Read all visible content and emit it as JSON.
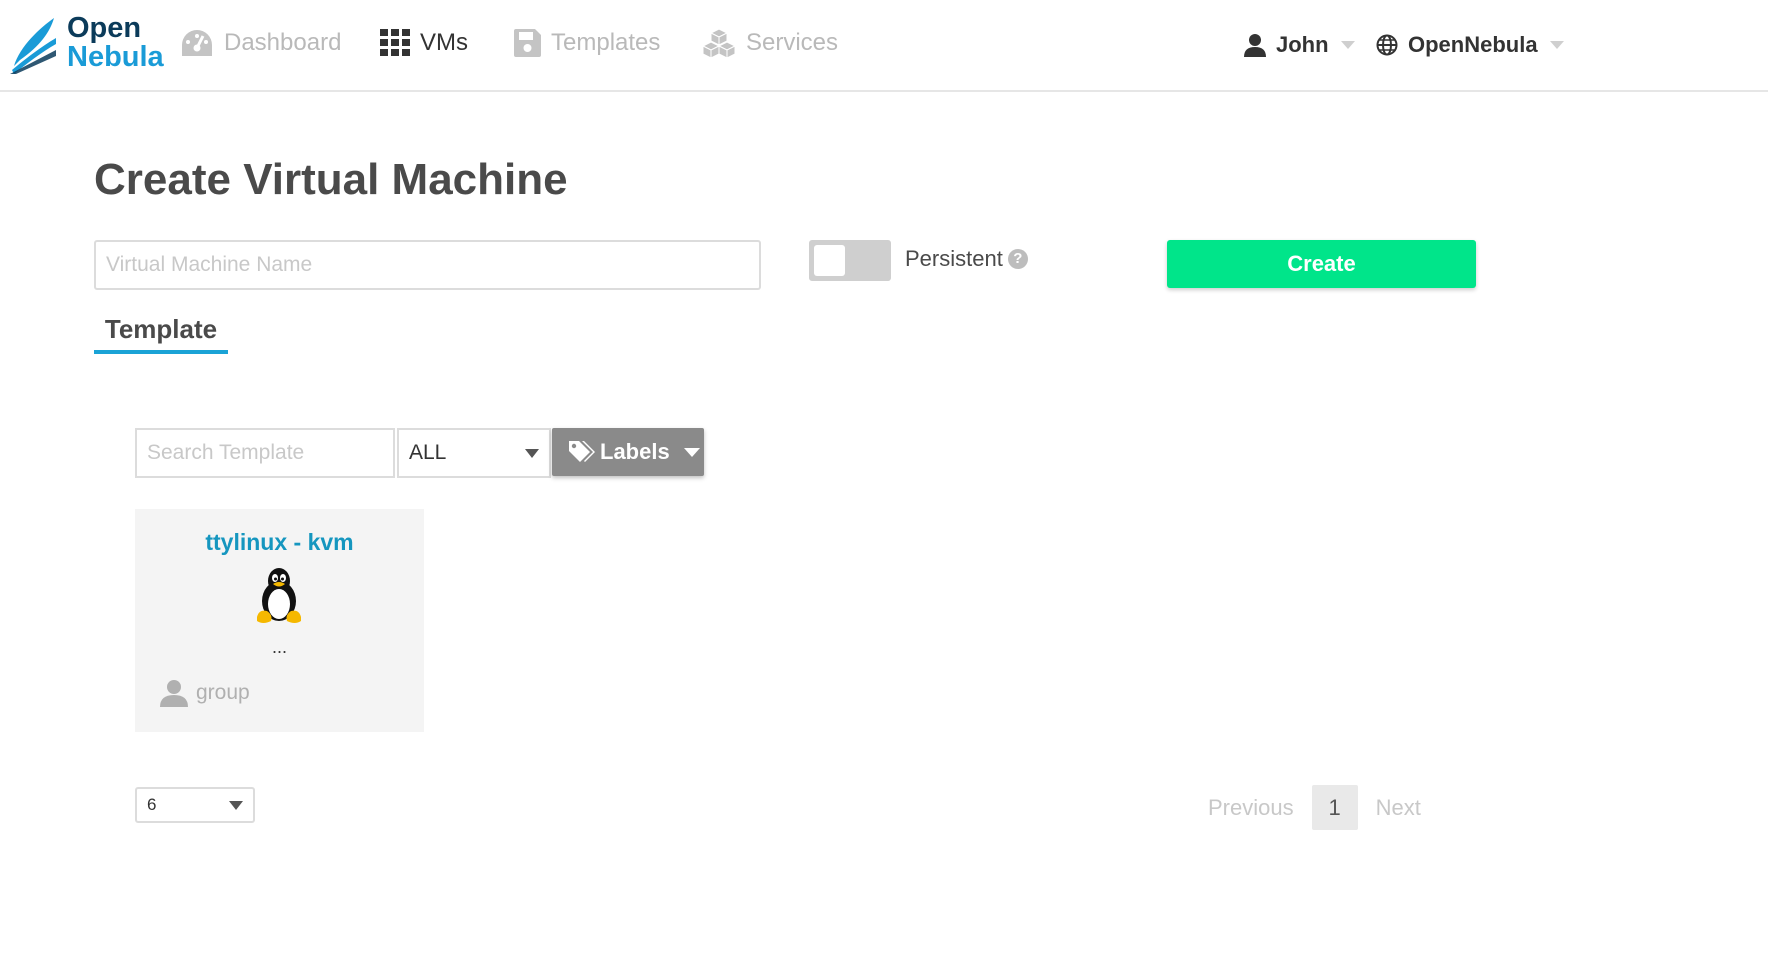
{
  "brand": {
    "line1": "Open",
    "line2": "Nebula"
  },
  "nav": {
    "dashboard": "Dashboard",
    "vms": "VMs",
    "templates": "Templates",
    "services": "Services"
  },
  "user_menu": {
    "user": "John",
    "zone": "OpenNebula"
  },
  "page": {
    "title": "Create Virtual Machine"
  },
  "form": {
    "vm_name_placeholder": "Virtual Machine Name",
    "persistent_label": "Persistent",
    "persistent_help": "?",
    "persistent_on": false,
    "create_label": "Create"
  },
  "tabs": {
    "template": "Template"
  },
  "filters": {
    "search_placeholder": "Search Template",
    "select_value": "ALL",
    "labels_button": "Labels"
  },
  "templates": [
    {
      "name": "ttylinux - kvm",
      "icon": "tux-linux-icon",
      "description": "...",
      "owner": "group"
    }
  ],
  "pagination": {
    "page_length": "6",
    "previous": "Previous",
    "current": "1",
    "next": "Next"
  },
  "colors": {
    "accent": "#1aa3d6",
    "create_button": "#00e58a",
    "labels_button": "#8a8a8a",
    "card_title": "#1596bf"
  }
}
